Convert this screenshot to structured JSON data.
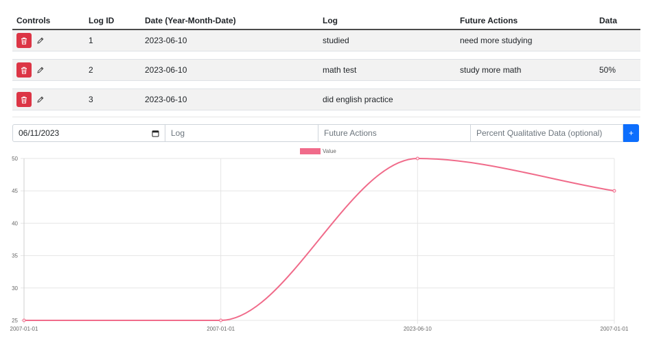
{
  "table": {
    "headers": [
      "Controls",
      "Log ID",
      "Date (Year-Month-Date)",
      "Log",
      "Future Actions",
      "Data"
    ],
    "rows": [
      {
        "id": "1",
        "date": "2023-06-10",
        "log": "studied",
        "future": "need more studying",
        "data": ""
      },
      {
        "id": "2",
        "date": "2023-06-10",
        "log": "math test",
        "future": "study more math",
        "data": "50%"
      },
      {
        "id": "3",
        "date": "2023-06-10",
        "log": "did english practice",
        "future": "",
        "data": ""
      }
    ]
  },
  "form": {
    "date_value": "06/11/2023",
    "log_placeholder": "Log",
    "future_placeholder": "Future Actions",
    "percent_placeholder": "Percent Qualitative Data (optional)",
    "add_label": "+"
  },
  "chart_data": {
    "type": "line",
    "categories": [
      "2007-01-01",
      "2007-01-01",
      "2023-06-10",
      "2007-01-01"
    ],
    "series": [
      {
        "name": "Value",
        "values": [
          25,
          25,
          50,
          45
        ],
        "color": "#f06b8a"
      }
    ],
    "ylim": [
      25,
      50
    ],
    "yticks": [
      25,
      30,
      35,
      40,
      45,
      50
    ],
    "grid": true,
    "legend": "top-center"
  },
  "icons": {
    "delete": "trash-icon",
    "edit": "pencil-icon",
    "calendar": "calendar-icon"
  },
  "colors": {
    "danger": "#dc3545",
    "primary": "#0d6efd",
    "line": "#f06b8a"
  }
}
